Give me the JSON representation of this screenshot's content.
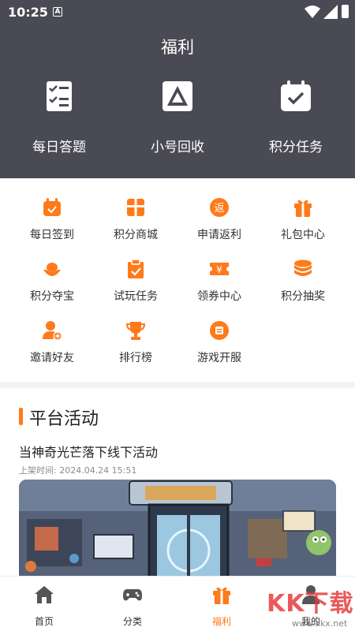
{
  "status_bar": {
    "time": "10:25",
    "a_badge": "A"
  },
  "header": {
    "title": "福利"
  },
  "top_features": [
    {
      "label": "每日答题",
      "icon": "checklist-icon"
    },
    {
      "label": "小号回收",
      "icon": "recycle-triangle-icon"
    },
    {
      "label": "积分任务",
      "icon": "calendar-check-icon"
    }
  ],
  "grid": [
    {
      "label": "每日签到",
      "icon": "calendar-signin-icon"
    },
    {
      "label": "积分商城",
      "icon": "gift-box-icon"
    },
    {
      "label": "申请返利",
      "icon": "rebate-icon",
      "glyph": "返"
    },
    {
      "label": "礼包中心",
      "icon": "gift-package-icon"
    },
    {
      "label": "积分夺宝",
      "icon": "gold-ingot-icon"
    },
    {
      "label": "试玩任务",
      "icon": "clipboard-check-icon"
    },
    {
      "label": "领券中心",
      "icon": "coupon-icon",
      "glyph": "¥"
    },
    {
      "label": "积分抽奖",
      "icon": "coins-stack-icon"
    },
    {
      "label": "邀请好友",
      "icon": "add-user-icon"
    },
    {
      "label": "排行榜",
      "icon": "trophy-icon"
    },
    {
      "label": "游戏开服",
      "icon": "server-open-icon"
    }
  ],
  "activity": {
    "section_title": "平台活动",
    "item_title": "当神奇光芒落下线下活动",
    "item_time": "上架时间: 2024.04.24 15:51"
  },
  "bottom_nav": [
    {
      "label": "首页",
      "icon": "home-icon",
      "active": false
    },
    {
      "label": "分类",
      "icon": "gamepad-icon",
      "active": false
    },
    {
      "label": "福利",
      "icon": "gift-icon",
      "active": true
    },
    {
      "label": "我的",
      "icon": "profile-icon",
      "active": false
    }
  ],
  "watermark": {
    "brand": "KK下载",
    "url": "www.kkx.net"
  },
  "colors": {
    "accent": "#ff7a1a",
    "header_bg": "#4a4a55",
    "divider": "#f3f3f5"
  }
}
